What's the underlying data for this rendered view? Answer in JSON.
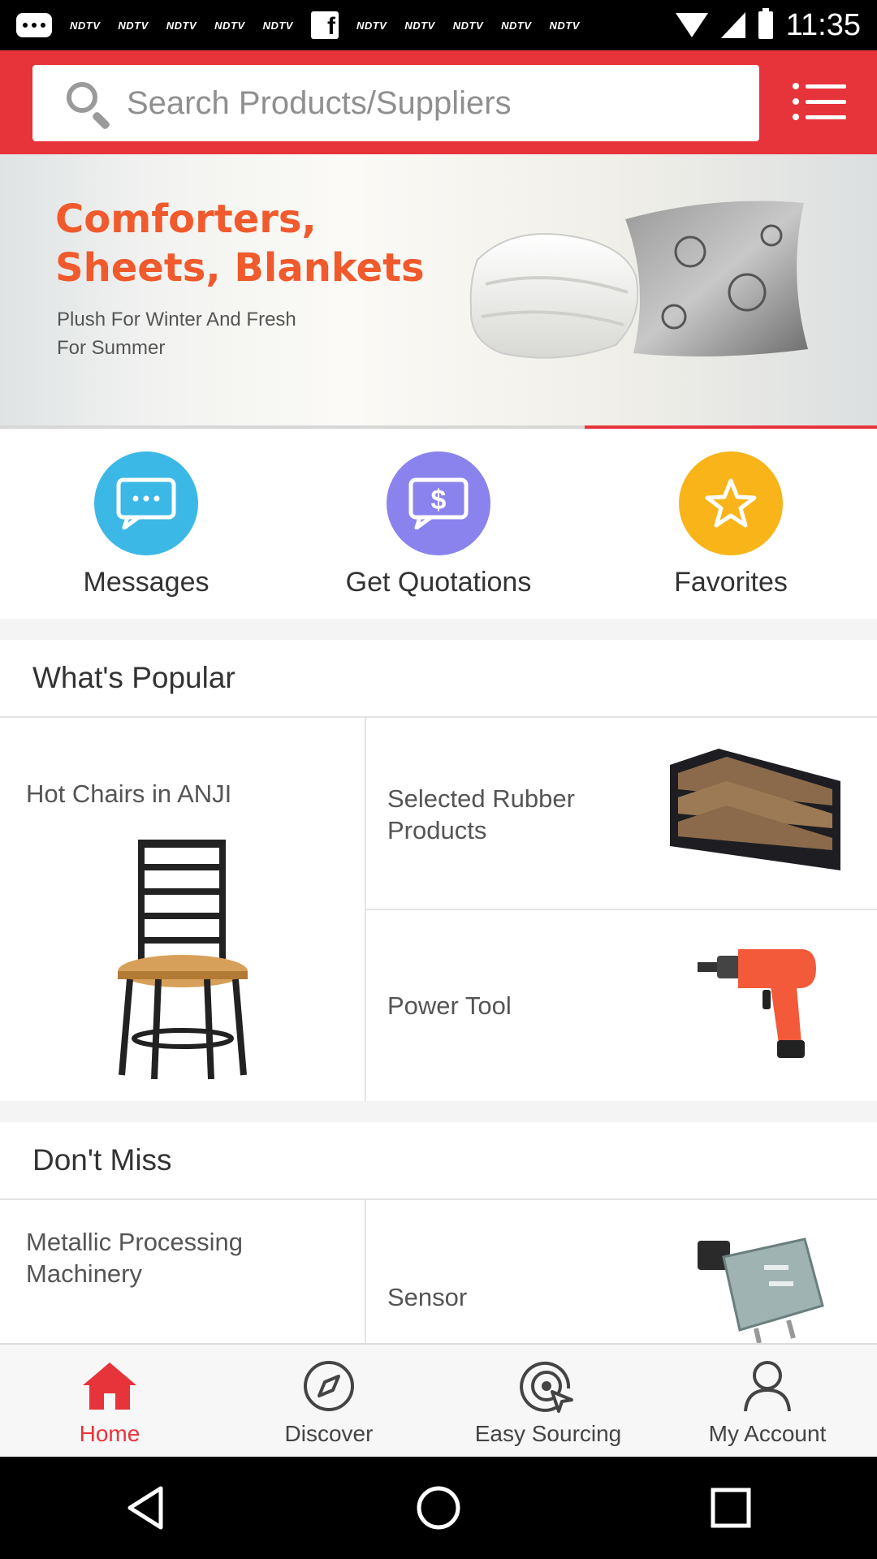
{
  "status_bar": {
    "notifications": [
      "NDTV",
      "NDTV",
      "NDTV",
      "NDTV",
      "NDTV",
      "NDTV",
      "NDTV",
      "NDTV",
      "NDTV",
      "NDTV"
    ],
    "time": "11:35"
  },
  "search": {
    "placeholder": "Search Products/Suppliers"
  },
  "banner": {
    "title": "Comforters,\nSheets, Blankets",
    "subtitle": "Plush For Winter And Fresh\nFor Summer",
    "active_slide": 2,
    "total_slides": 3
  },
  "quick_actions": [
    {
      "label": "Messages",
      "icon": "chat-bubble-icon",
      "color": "#3cb8e6"
    },
    {
      "label": "Get Quotations",
      "icon": "quotation-dollar-icon",
      "color": "#8a83ee"
    },
    {
      "label": "Favorites",
      "icon": "star-icon",
      "color": "#f8b419"
    }
  ],
  "popular": {
    "title": "What's Popular",
    "items": [
      {
        "label": "Hot Chairs in ANJI",
        "image": "bar-stool-image"
      },
      {
        "label": "Selected Rubber\nProducts",
        "image": "rubber-belt-image"
      },
      {
        "label": "Power Tool",
        "image": "power-drill-image"
      }
    ]
  },
  "dont_miss": {
    "title": "Don't Miss",
    "items": [
      {
        "label": "Metallic Processing\nMachinery"
      },
      {
        "label": "Sensor",
        "image": "pressure-sensor-image"
      }
    ]
  },
  "bottom_nav": [
    {
      "label": "Home",
      "icon": "home-icon",
      "active": true
    },
    {
      "label": "Discover",
      "icon": "compass-icon",
      "active": false
    },
    {
      "label": "Easy Sourcing",
      "icon": "sourcing-target-icon",
      "active": false
    },
    {
      "label": "My Account",
      "icon": "user-icon",
      "active": false
    }
  ],
  "colors": {
    "brand_red": "#e7333a",
    "banner_orange": "#f05a2c"
  }
}
